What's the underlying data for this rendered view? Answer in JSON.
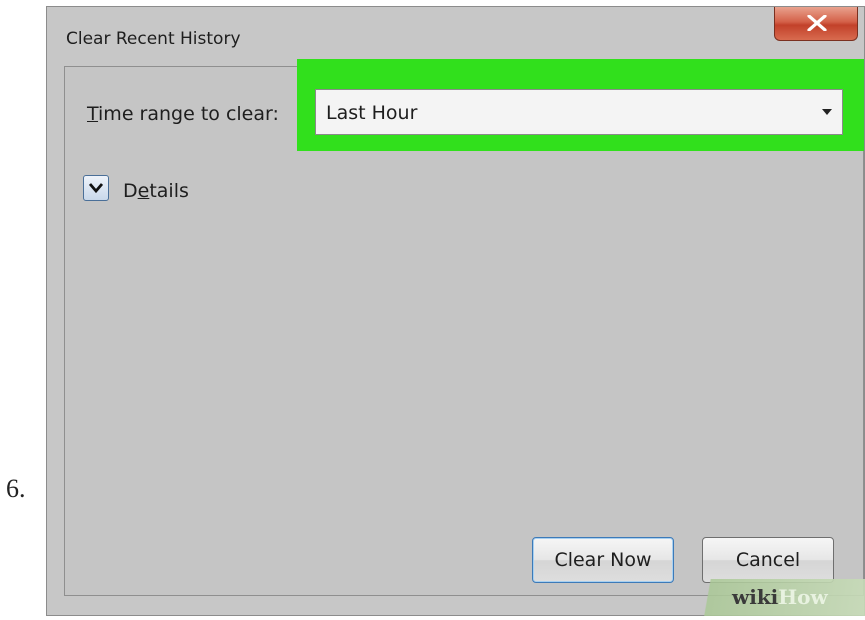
{
  "step": {
    "number": "6."
  },
  "dialog": {
    "title": "Clear Recent History",
    "close_icon": "close-x-icon"
  },
  "time_range": {
    "label_accel": "T",
    "label_rest": "ime range to clear:",
    "selected": "Last Hour",
    "highlight_color": "#31e01c"
  },
  "details": {
    "label_pre": "D",
    "label_accel": "e",
    "label_post": "tails",
    "icon": "chevron-down-icon"
  },
  "buttons": {
    "clear_now": "Clear Now",
    "cancel": "Cancel"
  },
  "watermark": {
    "wiki": "wiki",
    "how": "How"
  }
}
